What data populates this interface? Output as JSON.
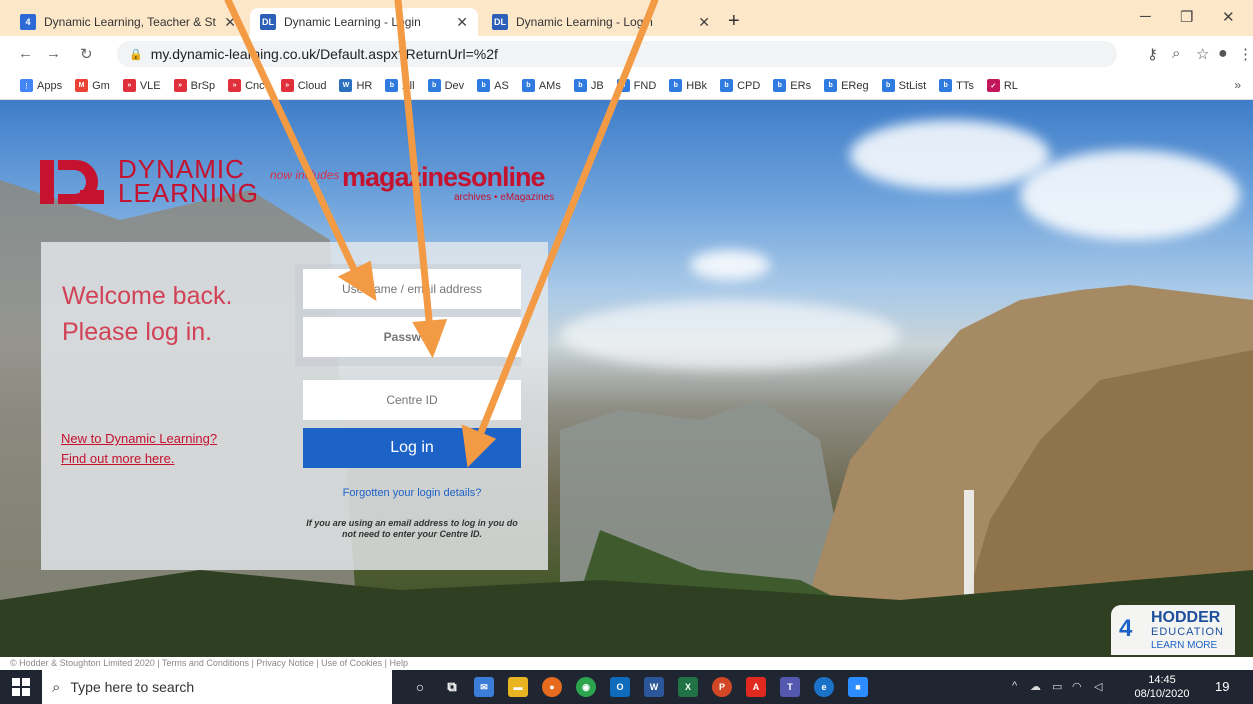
{
  "browser": {
    "tabs": [
      {
        "title": "Dynamic Learning, Teacher & Stu"
      },
      {
        "title": "Dynamic Learning - Login"
      },
      {
        "title": "Dynamic Learning - Login"
      }
    ],
    "url": "my.dynamic-learning.co.uk/Default.aspx?ReturnUrl=%2f",
    "bookmarks": [
      "Apps",
      "Gm",
      "VLE",
      "BrSp",
      "Cnct",
      "Cloud",
      "HR",
      "All",
      "Dev",
      "AS",
      "AMs",
      "JB",
      "FND",
      "HBk",
      "CPD",
      "ERs",
      "EReg",
      "StList",
      "TTs",
      "RL"
    ],
    "bookmarks_more": "»"
  },
  "brand": {
    "dynamic": "DYNAMIC",
    "learning": "LEARNING",
    "now_includes": "now includes",
    "magazines": "magazinesonline",
    "magazines_sub": "archives • eMagazines"
  },
  "login": {
    "welcome_line1": "Welcome back.",
    "welcome_line2": "Please log in.",
    "username_placeholder": "Username / email address",
    "password_placeholder": "Password",
    "centre_placeholder": "Centre ID",
    "login_button": "Log in",
    "forgot_link": "Forgotten your login details?",
    "email_note": "If you are using an email address to log in you do not need to enter your Centre ID.",
    "new_line1": "New to Dynamic Learning?",
    "new_line2": "Find out more here."
  },
  "hodder": {
    "line1": "HODDER",
    "line2": "EDUCATION",
    "line3": "LEARN MORE"
  },
  "footer": "© Hodder & Stoughton Limited 2020 | Terms and Conditions | Privacy Notice | Use of Cookies | Help",
  "taskbar": {
    "search_placeholder": "Type here to search",
    "time": "14:45",
    "date": "08/10/2020",
    "notification_count": "19"
  },
  "colors": {
    "brand_red": "#c4122f",
    "button_blue": "#1d62c7",
    "arrow_orange": "#f39a45"
  }
}
